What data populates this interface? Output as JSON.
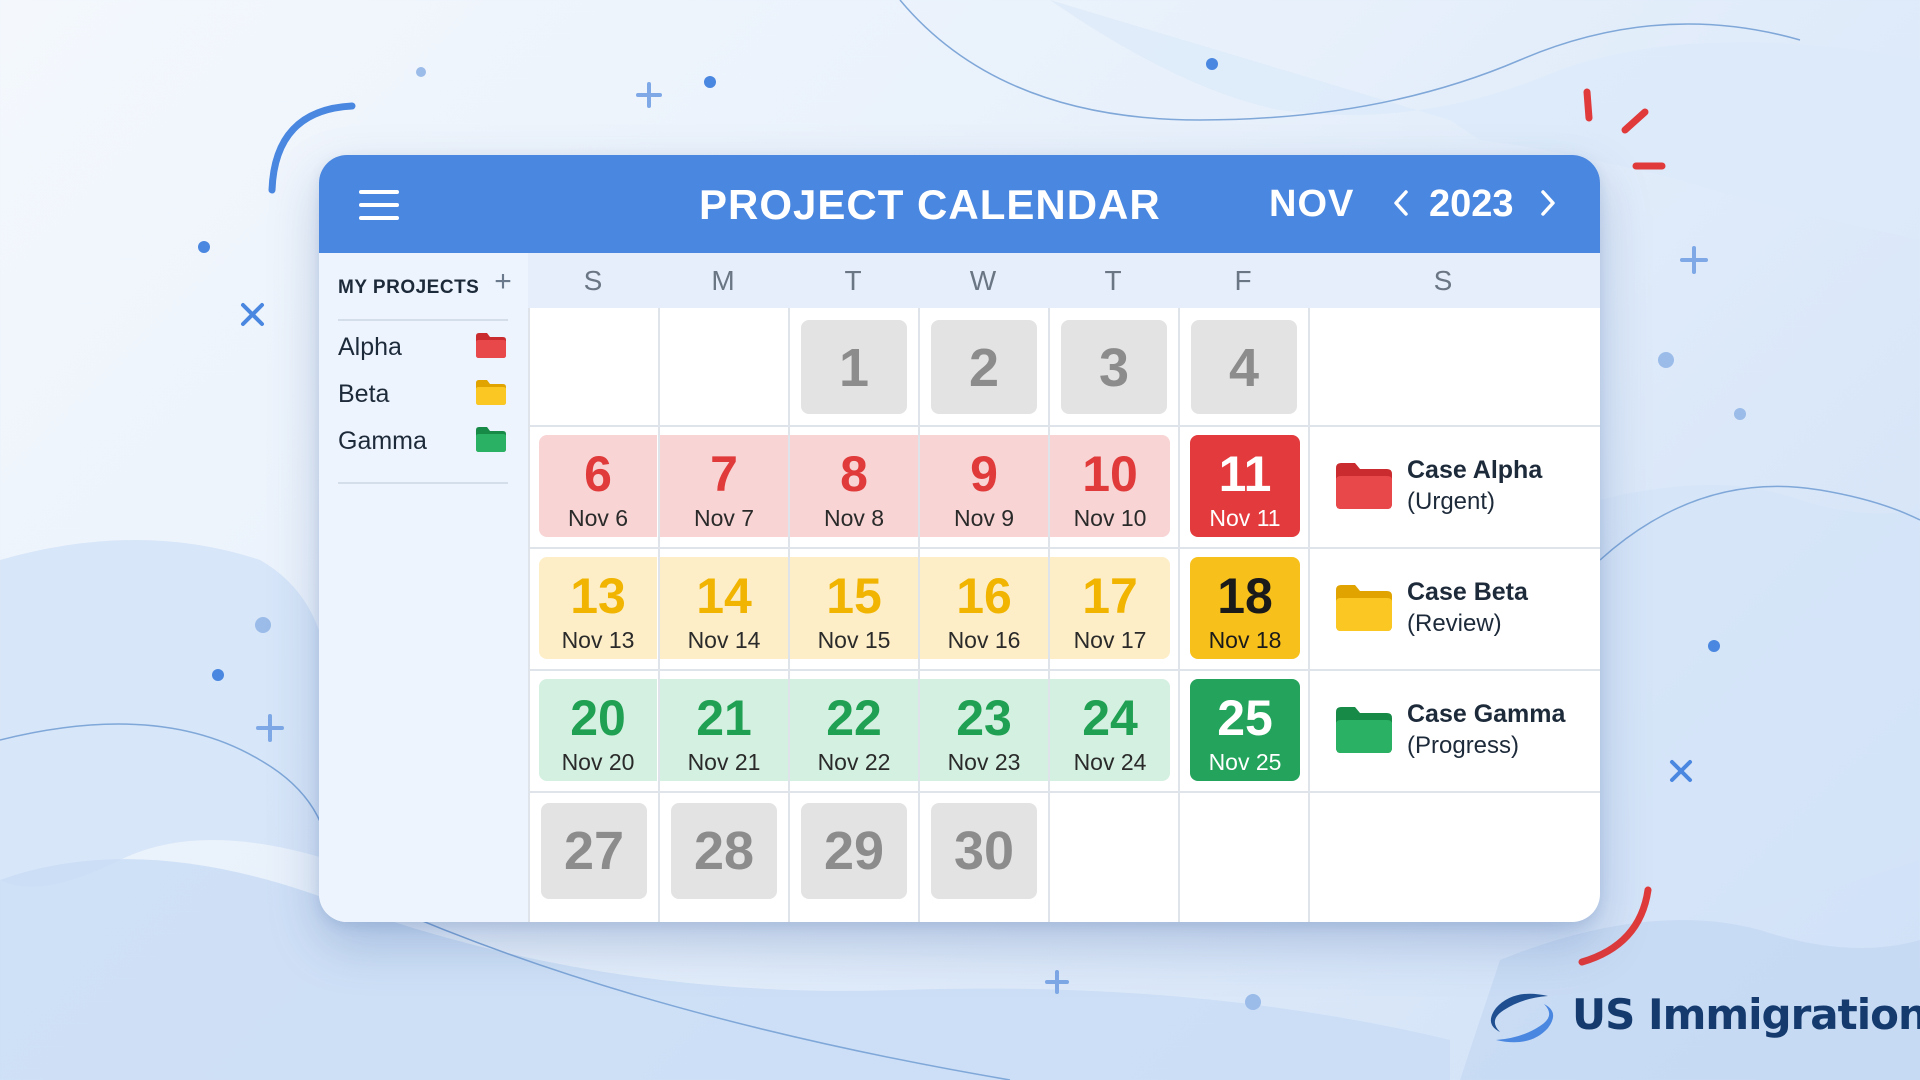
{
  "header": {
    "title": "PROJECT CALENDAR",
    "month": "NOV",
    "year": "2023",
    "prev_icon": "chevron-left-icon",
    "next_icon": "chevron-right-icon",
    "menu_icon": "hamburger-menu-icon"
  },
  "sidebar": {
    "heading": "MY PROJECTS",
    "add_label": "+",
    "projects": [
      {
        "label": "Alpha",
        "icon": "folder-icon",
        "color": "#e33a3d"
      },
      {
        "label": "Beta",
        "icon": "folder-icon",
        "color": "#f7c01b"
      },
      {
        "label": "Gamma",
        "icon": "folder-icon",
        "color": "#23a35b"
      }
    ]
  },
  "weekdays": [
    "S",
    "M",
    "T",
    "W",
    "T",
    "F",
    "S"
  ],
  "weeks": {
    "w1": [
      {
        "num": "1"
      },
      {
        "num": "2"
      },
      {
        "num": "3"
      },
      {
        "num": "4"
      }
    ],
    "w2": [
      {
        "num": "6",
        "label": "Nov 6"
      },
      {
        "num": "7",
        "label": "Nov 7"
      },
      {
        "num": "8",
        "label": "Nov 8"
      },
      {
        "num": "9",
        "label": "Nov 9"
      },
      {
        "num": "10",
        "label": "Nov 10"
      },
      {
        "num": "11",
        "label": "Nov 11"
      }
    ],
    "w3": [
      {
        "num": "13",
        "label": "Nov 13"
      },
      {
        "num": "14",
        "label": "Nov 14"
      },
      {
        "num": "15",
        "label": "Nov 15"
      },
      {
        "num": "16",
        "label": "Nov 16"
      },
      {
        "num": "17",
        "label": "Nov 17"
      },
      {
        "num": "18",
        "label": "Nov 18"
      }
    ],
    "w4": [
      {
        "num": "20",
        "label": "Nov 20"
      },
      {
        "num": "21",
        "label": "Nov 21"
      },
      {
        "num": "22",
        "label": "Nov 22"
      },
      {
        "num": "23",
        "label": "Nov 23"
      },
      {
        "num": "24",
        "label": "Nov 24"
      },
      {
        "num": "25",
        "label": "Nov 25"
      }
    ],
    "w5": [
      {
        "num": "27"
      },
      {
        "num": "28"
      },
      {
        "num": "29"
      },
      {
        "num": "30"
      }
    ]
  },
  "cases": [
    {
      "name": "Case Alpha",
      "status": "(Urgent)",
      "color": "#e33a3d"
    },
    {
      "name": "Case Beta",
      "status": "(Review)",
      "color": "#f7c01b"
    },
    {
      "name": "Case Gamma",
      "status": "(Progress)",
      "color": "#23a35b"
    }
  ],
  "brand": {
    "name": "US Immigration AI",
    "mark_icon": "swoosh-logo-icon"
  },
  "colors": {
    "header": "#4a87e0",
    "urgent": "#e33a3d",
    "review": "#f7c01b",
    "progress": "#23a35b",
    "past_day": "#e3e3e3"
  }
}
